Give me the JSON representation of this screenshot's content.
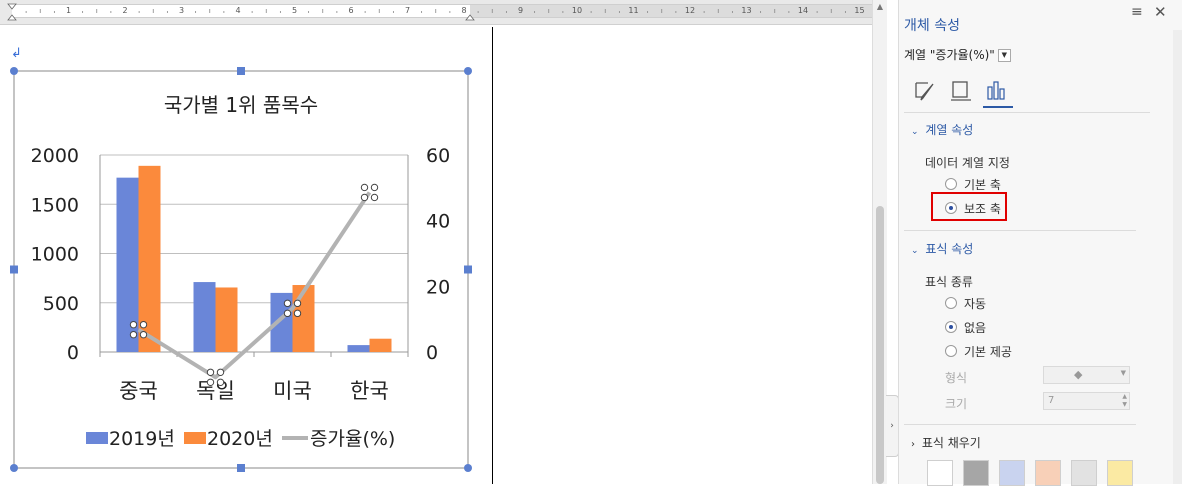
{
  "ruler": {
    "numbers": [
      "1",
      "2",
      "3",
      "4",
      "5",
      "6",
      "7",
      "8",
      "9",
      "10",
      "11",
      "12",
      "13",
      "14",
      "15"
    ]
  },
  "paragraph_mark": "↲",
  "chart_data": {
    "type": "bar",
    "title": "국가별 1위 품목수",
    "categories": [
      "중국",
      "독일",
      "미국",
      "한국"
    ],
    "series": [
      {
        "name": "2019년",
        "type": "bar",
        "axis": "primary",
        "color": "#6a86d8",
        "values": [
          1770,
          710,
          600,
          70
        ]
      },
      {
        "name": "2020년",
        "type": "bar",
        "axis": "primary",
        "color": "#fb8a3c",
        "values": [
          1890,
          655,
          680,
          135
        ]
      },
      {
        "name": "증가율(%)",
        "type": "line",
        "axis": "secondary",
        "color": "#b3b3b3",
        "values": [
          6.8,
          -7.7,
          13.3,
          48.6
        ]
      }
    ],
    "y_primary": {
      "min": 0,
      "max": 2000,
      "ticks": [
        "0",
        "500",
        "1000",
        "1500",
        "2000"
      ]
    },
    "y_secondary": {
      "min": 0,
      "max": 60,
      "ticks": [
        "0",
        "20",
        "40",
        "60"
      ]
    },
    "grid": true,
    "legend_position": "bottom"
  },
  "panel": {
    "title": "개체 속성",
    "series_label": "계열 \"증가율(%)\"",
    "sections": {
      "series_props": "계열 속성",
      "marker_props": "표식 속성",
      "marker_fill": "표식 채우기"
    },
    "data_series_label": "데이터 계열 지정",
    "axis_options": [
      {
        "label": "기본 축",
        "selected": false
      },
      {
        "label": "보조 축",
        "selected": true
      }
    ],
    "marker_type_label": "표식 종류",
    "marker_options": [
      {
        "label": "자동",
        "selected": false
      },
      {
        "label": "없음",
        "selected": true
      },
      {
        "label": "기본 제공",
        "selected": false
      }
    ],
    "shape_label": "형식",
    "size_label": "크기",
    "size_value": "7",
    "fill_swatches": [
      "#ffffff",
      "#a6a6a6",
      "#c9d3ef",
      "#f8d0b8",
      "#e2e2e2",
      "#fbeaa3"
    ]
  }
}
